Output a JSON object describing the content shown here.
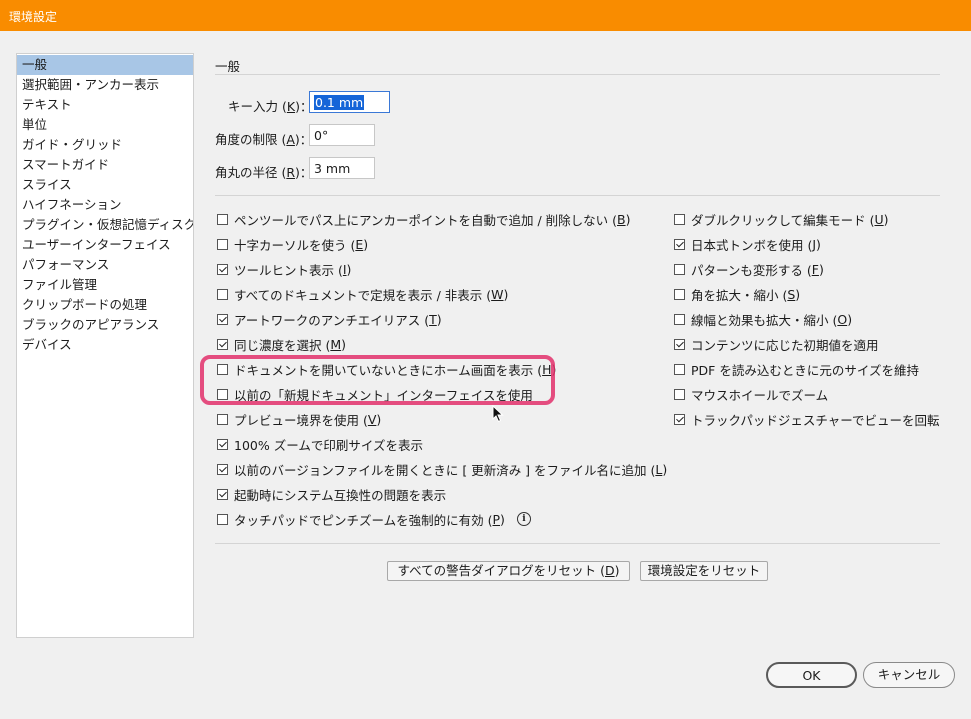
{
  "window": {
    "title": "環境設定"
  },
  "sidebar": {
    "items": [
      {
        "label": "一般"
      },
      {
        "label": "選択範囲・アンカー表示"
      },
      {
        "label": "テキスト"
      },
      {
        "label": "単位"
      },
      {
        "label": "ガイド・グリッド"
      },
      {
        "label": "スマートガイド"
      },
      {
        "label": "スライス"
      },
      {
        "label": "ハイフネーション"
      },
      {
        "label": "プラグイン・仮想記憶ディスク"
      },
      {
        "label": "ユーザーインターフェイス"
      },
      {
        "label": "パフォーマンス"
      },
      {
        "label": "ファイル管理"
      },
      {
        "label": "クリップボードの処理"
      },
      {
        "label": "ブラックのアピアランス"
      },
      {
        "label": "デバイス"
      }
    ]
  },
  "general": {
    "section_title": "一般",
    "key_input": {
      "label_pre": "キー入力 (",
      "key": "K",
      "label_post": ")：",
      "value": "0.1 mm"
    },
    "angle_limit": {
      "label_pre": "角度の制限 (",
      "key": "A",
      "label_post": ")：",
      "value": "0°"
    },
    "corner_radius": {
      "label_pre": "角丸の半径 (",
      "key": "R",
      "label_post": ")：",
      "value": "3 mm"
    }
  },
  "left_options": [
    {
      "pre": "ペンツールでパス上にアンカーポイントを自動で追加 / 削除しない (",
      "key": "B",
      "post": ")",
      "checked": false
    },
    {
      "pre": "十字カーソルを使う (",
      "key": "E",
      "post": ")",
      "checked": false
    },
    {
      "pre": "ツールヒント表示 (",
      "key": "I",
      "post": ")",
      "checked": true
    },
    {
      "pre": "すべてのドキュメントで定規を表示 / 非表示 (",
      "key": "W",
      "post": ")",
      "checked": false
    },
    {
      "pre": "アートワークのアンチエイリアス (",
      "key": "T",
      "post": ")",
      "checked": true
    },
    {
      "pre": "同じ濃度を選択 (",
      "key": "M",
      "post": ")",
      "checked": true
    },
    {
      "pre": "ドキュメントを開いていないときにホーム画面を表示 (",
      "key": "H",
      "post": ")",
      "checked": false
    },
    {
      "pre": "以前の「新規ドキュメント」インターフェイスを使用",
      "key": "",
      "post": "",
      "checked": false
    },
    {
      "pre": "プレビュー境界を使用 (",
      "key": "V",
      "post": ")",
      "checked": false
    },
    {
      "pre": "100% ズームで印刷サイズを表示",
      "key": "",
      "post": "",
      "checked": true
    },
    {
      "pre": "以前のバージョンファイルを開くときに [ 更新済み ] をファイル名に追加 (",
      "key": "L",
      "post": ")",
      "checked": true
    },
    {
      "pre": "起動時にシステム互換性の問題を表示",
      "key": "",
      "post": "",
      "checked": true
    },
    {
      "pre": "タッチパッドでピンチズームを強制的に有効 (",
      "key": "P",
      "post": ")",
      "checked": false
    }
  ],
  "right_options": [
    {
      "pre": "ダブルクリックして編集モード (",
      "key": "U",
      "post": ")",
      "checked": false
    },
    {
      "pre": "日本式トンボを使用 (",
      "key": "J",
      "post": ")",
      "checked": true
    },
    {
      "pre": "パターンも変形する (",
      "key": "F",
      "post": ")",
      "checked": false
    },
    {
      "pre": "角を拡大・縮小 (",
      "key": "S",
      "post": ")",
      "checked": false
    },
    {
      "pre": "線幅と効果も拡大・縮小 (",
      "key": "O",
      "post": ")",
      "checked": false
    },
    {
      "pre": "コンテンツに応じた初期値を適用",
      "key": "",
      "post": "",
      "checked": true
    },
    {
      "pre": "PDF を読み込むときに元のサイズを維持",
      "key": "",
      "post": "",
      "checked": false
    },
    {
      "pre": "マウスホイールでズーム",
      "key": "",
      "post": "",
      "checked": false
    },
    {
      "pre": "トラックパッドジェスチャーでビューを回転",
      "key": "",
      "post": "",
      "checked": true
    }
  ],
  "info_icon": "info-icon",
  "buttons": {
    "reset_warnings": {
      "pre": "すべての警告ダイアログをリセット (",
      "key": "D",
      "post": ")"
    },
    "reset_prefs": "環境設定をリセット",
    "ok": "OK",
    "cancel": "キャンセル"
  },
  "colors": {
    "titlebar": "#f98c00",
    "selection": "#a8c6e6",
    "highlight": "#e2306b"
  }
}
